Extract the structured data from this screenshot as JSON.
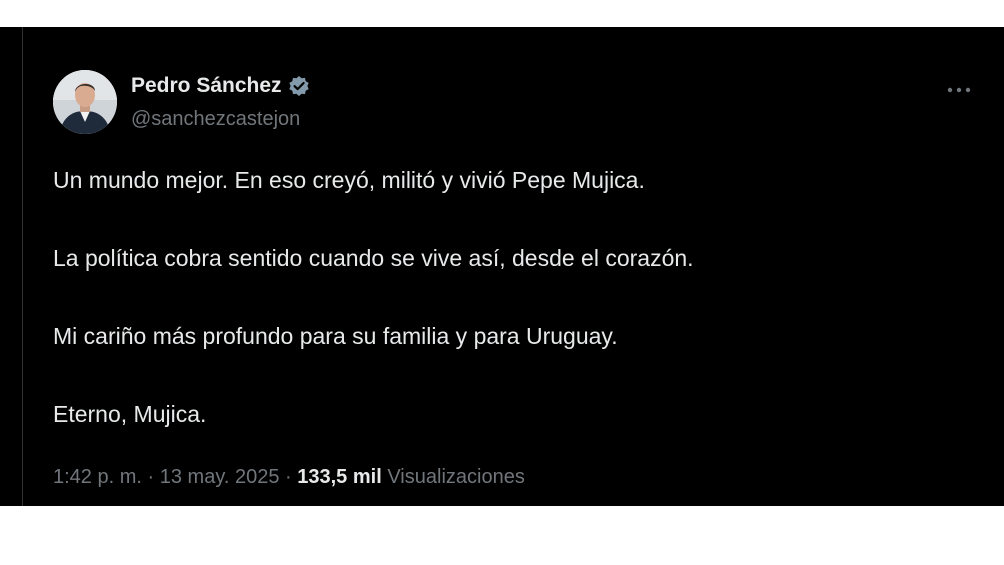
{
  "tweet": {
    "author": {
      "name": "Pedro Sánchez",
      "handle": "@sanchezcastejon",
      "verified": true
    },
    "paragraphs": [
      "Un mundo mejor. En eso creyó, militó y vivió Pepe Mujica.",
      "La política cobra sentido cuando se vive así, desde el corazón.",
      "Mi cariño más profundo para su familia y para Uruguay.",
      "Eterno, Mujica."
    ],
    "meta": {
      "time": "1:42 p. m.",
      "separator": "·",
      "date": "13 may. 2025",
      "views_count": "133,5 mil",
      "views_label": "Visualizaciones"
    }
  },
  "icons": {
    "verified": "verified-badge-icon",
    "more": "more-options-icon",
    "avatar": "profile-photo"
  },
  "colors": {
    "background": "#000000",
    "text_primary": "#e7e9ea",
    "text_secondary": "#71767b",
    "verified_badge": "#829aab"
  }
}
